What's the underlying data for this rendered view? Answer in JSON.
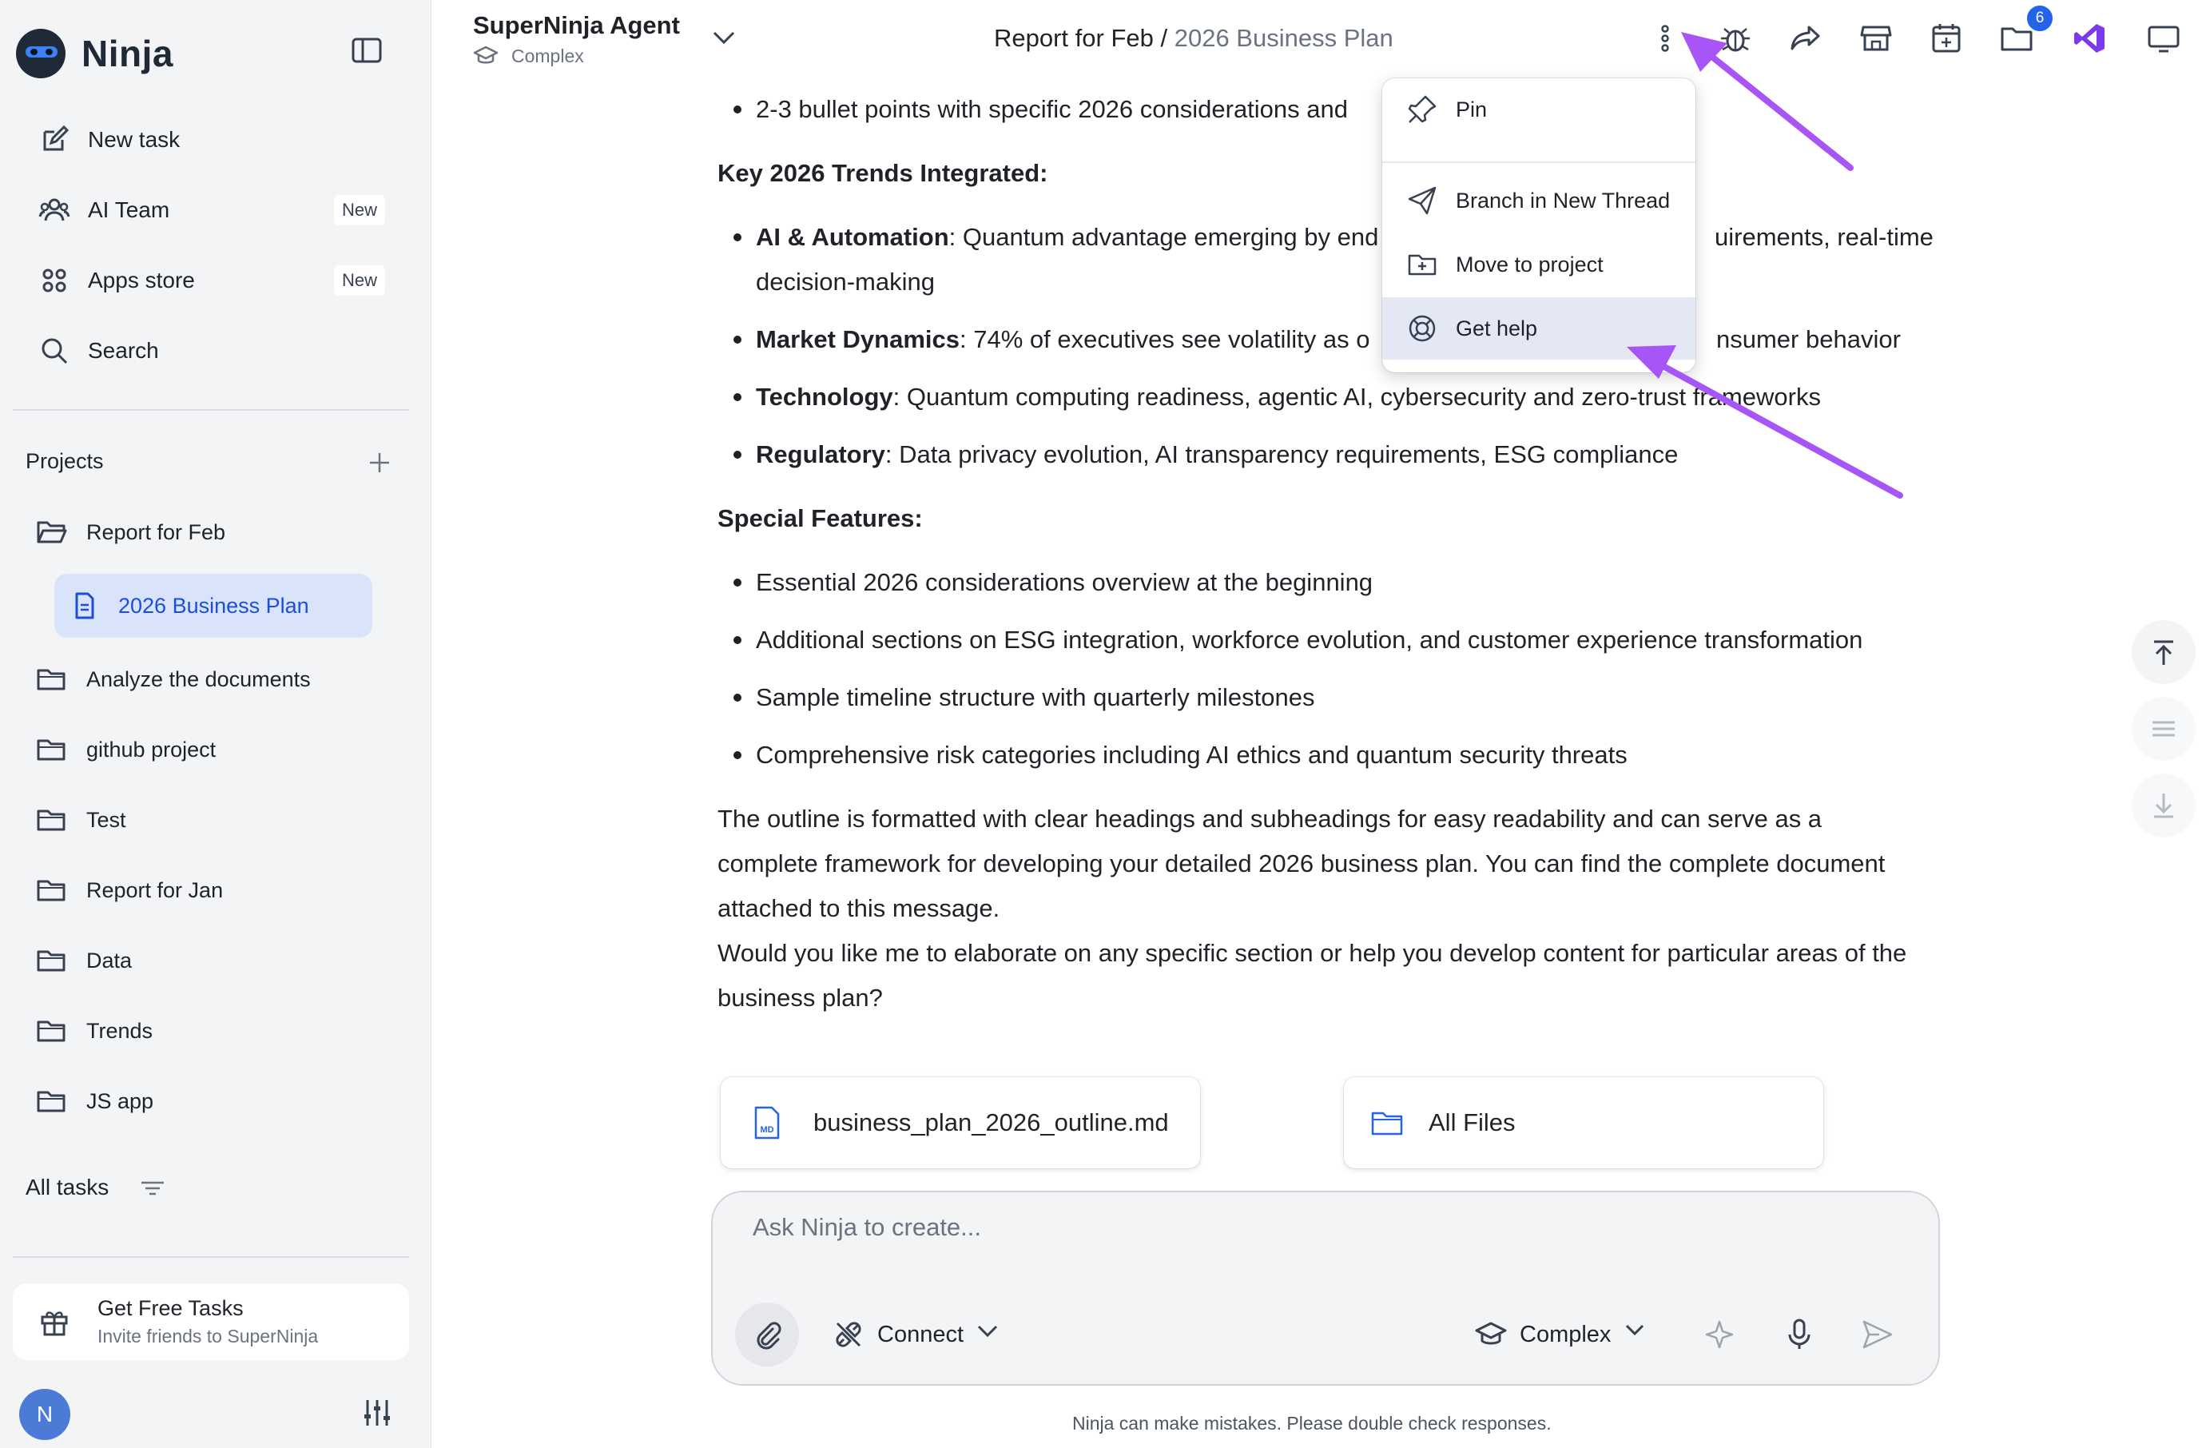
{
  "sidebar": {
    "logo_text": "Ninja",
    "nav": [
      {
        "label": "New task",
        "icon": "edit-icon",
        "badge": ""
      },
      {
        "label": "AI Team",
        "icon": "team-icon",
        "badge": "New"
      },
      {
        "label": "Apps store",
        "icon": "apps-icon",
        "badge": "New"
      },
      {
        "label": "Search",
        "icon": "search-icon",
        "badge": ""
      }
    ],
    "projects_label": "Projects",
    "projects": [
      {
        "label": "Report for Feb",
        "icon": "folder-open-icon"
      },
      {
        "label": "2026 Business Plan",
        "icon": "document-icon",
        "selected": true
      },
      {
        "label": "Analyze the documents",
        "icon": "folder-icon"
      },
      {
        "label": "github project",
        "icon": "folder-icon"
      },
      {
        "label": "Test",
        "icon": "folder-icon"
      },
      {
        "label": "Report for Jan",
        "icon": "folder-icon"
      },
      {
        "label": "Data",
        "icon": "folder-icon"
      },
      {
        "label": "Trends",
        "icon": "folder-icon"
      },
      {
        "label": "JS app",
        "icon": "folder-icon"
      }
    ],
    "all_tasks_label": "All tasks",
    "free_tasks": {
      "title": "Get Free Tasks",
      "subtitle": "Invite friends to SuperNinja"
    },
    "user_initial": "N"
  },
  "header": {
    "agent_name": "SuperNinja Agent",
    "agent_mode": "Complex",
    "breadcrumb_parent": "Report for Feb",
    "breadcrumb_sep": " / ",
    "breadcrumb_current": "2026 Business Plan",
    "files_count": "6",
    "icons": [
      "more-vertical-icon",
      "bug-icon",
      "share-icon",
      "store-icon",
      "calendar-add-icon",
      "folder-icon",
      "vscode-icon",
      "monitor-icon"
    ]
  },
  "menu": {
    "items": [
      {
        "label": "Pin",
        "icon": "pin-icon"
      },
      {
        "label": "Branch in New Thread",
        "icon": "send-icon"
      },
      {
        "label": "Move to project",
        "icon": "folder-plus-icon"
      },
      {
        "label": "Get help",
        "icon": "lifebuoy-icon"
      }
    ]
  },
  "message": {
    "bullet_top_visible": "2-3 bullet points with specific 2026 considerations and",
    "trends_heading": "Key 2026 Trends Integrated:",
    "trends": [
      {
        "label": "AI & Automation",
        "text_a": ": Quantum advantage emerging by end",
        "text_b": "uirements, real-time",
        "text_c": "decision-making"
      },
      {
        "label": "Market Dynamics",
        "text_a": ": 74% of executives see volatility as o",
        "text_b": "nsumer behavior"
      },
      {
        "label": "Technology",
        "text_a": ": Quantum computing readiness, agentic AI, cybersecurity and zero-trust frameworks"
      },
      {
        "label": "Regulatory",
        "text_a": ": Data privacy evolution, AI transparency requirements, ESG compliance"
      }
    ],
    "features_heading": "Special Features:",
    "features": [
      "Essential 2026 considerations overview at the beginning",
      "Additional sections on ESG integration, workforce evolution, and customer experience transformation",
      "Sample timeline structure with quarterly milestones",
      "Comprehensive risk categories including AI ethics and quantum security threats"
    ],
    "para1_lines": [
      "The outline is formatted with clear headings and subheadings for easy readability and can serve as a",
      "complete framework for developing your detailed 2026 business plan. You can find the complete document",
      "attached to this message."
    ],
    "para2_lines": [
      "Would you like me to elaborate on any specific section or help you develop content for particular areas of the",
      "business plan?"
    ]
  },
  "attachments": {
    "file_name": "business_plan_2026_outline.md",
    "all_files_label": "All Files"
  },
  "composer": {
    "placeholder": "Ask Ninja to create...",
    "connect_label": "Connect",
    "mode_label": "Complex"
  },
  "disclaimer": "Ninja can make mistakes. Please double check responses.",
  "colors": {
    "accent": "#2563eb",
    "annotation_arrow": "#a855f7",
    "selected_bg": "#d9e4fb"
  }
}
